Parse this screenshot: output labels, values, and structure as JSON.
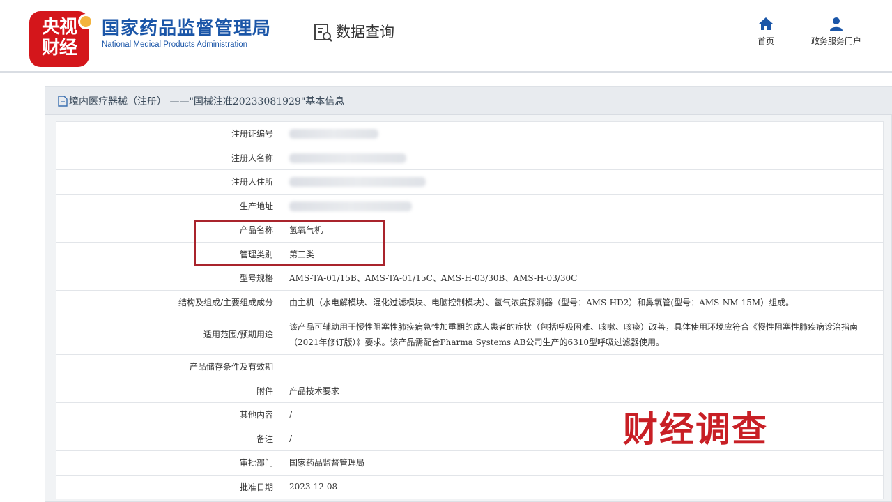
{
  "header": {
    "broadcaster_logo": "央视财经",
    "agency_name_cn": "国家药品监督管理局",
    "agency_name_en": "National Medical Products Administration",
    "section_title": "数据查询",
    "nav": [
      {
        "label": "首页",
        "icon": "home-icon"
      },
      {
        "label": "政务服务门户",
        "icon": "user-icon"
      }
    ]
  },
  "panel": {
    "title": "境内医疗器械（注册） ——\"国械注准20233081929\"基本信息"
  },
  "record": {
    "rows": [
      {
        "key": "注册证编号",
        "value": ""
      },
      {
        "key": "注册人名称",
        "value": ""
      },
      {
        "key": "注册人住所",
        "value": ""
      },
      {
        "key": "生产地址",
        "value": ""
      },
      {
        "key": "产品名称",
        "value": "氢氧气机"
      },
      {
        "key": "管理类别",
        "value": "第三类"
      },
      {
        "key": "型号规格",
        "value": "AMS-TA-01/15B、AMS-TA-01/15C、AMS-H-03/30B、AMS-H-03/30C"
      },
      {
        "key": "结构及组成/主要组成成分",
        "value": "由主机（水电解模块、混化过滤模块、电脑控制模块）、氢气浓度探测器（型号：AMS-HD2）和鼻氧管(型号：AMS-NM-15M）组成。"
      },
      {
        "key": "适用范围/预期用途",
        "value": "该产品可辅助用于慢性阻塞性肺疾病急性加重期的成人患者的症状（包括呼吸困难、咳嗽、咳痰）改善，具体使用环境应符合《慢性阻塞性肺疾病诊治指南（2021年修订版）》要求。该产品需配合Pharma Systems AB公司生产的6310型呼吸过滤器使用。"
      },
      {
        "key": "产品储存条件及有效期",
        "value": ""
      },
      {
        "key": "附件",
        "value": "产品技术要求"
      },
      {
        "key": "其他内容",
        "value": "/"
      },
      {
        "key": "备注",
        "value": "/"
      },
      {
        "key": "审批部门",
        "value": "国家药品监督管理局"
      },
      {
        "key": "批准日期",
        "value": "2023-12-08"
      }
    ]
  },
  "watermark": "财经调查",
  "colors": {
    "agency_blue": "#1b56a8",
    "cctv_red": "#d4161b",
    "highlight_red": "#a9242c"
  }
}
